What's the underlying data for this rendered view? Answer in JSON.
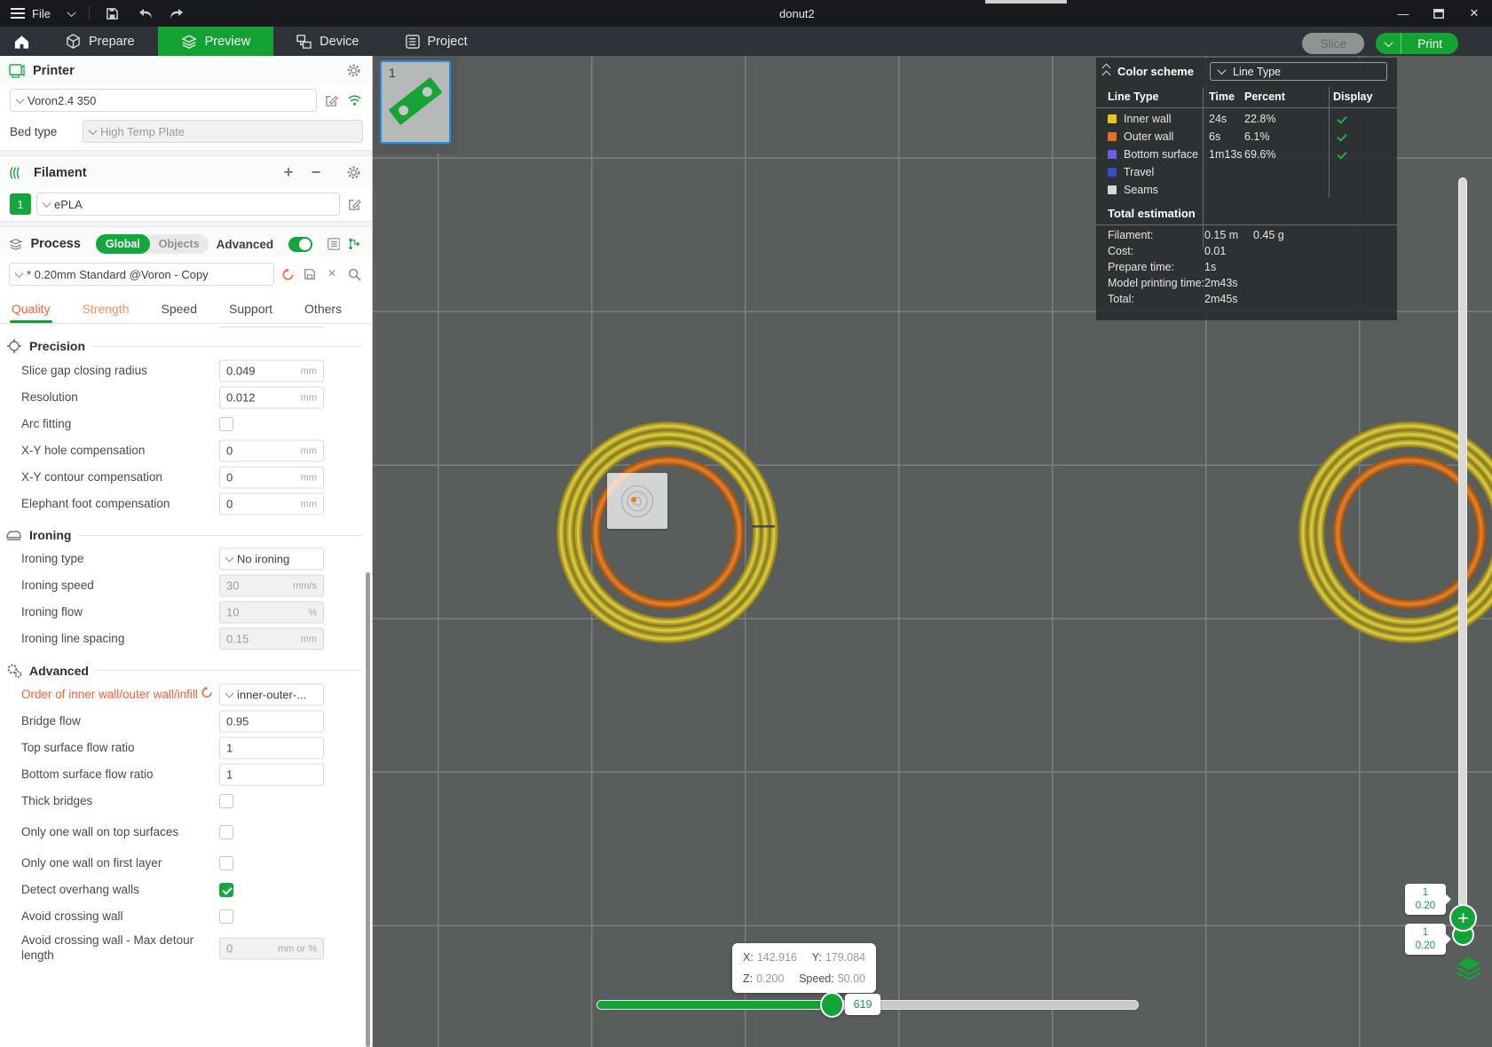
{
  "window": {
    "title": "donut2",
    "file_menu": "File"
  },
  "nav": {
    "tabs": [
      {
        "label": "Prepare"
      },
      {
        "label": "Preview"
      },
      {
        "label": "Device"
      },
      {
        "label": "Project"
      }
    ],
    "slice": "Slice",
    "print": "Print"
  },
  "colors": {
    "accent_green": "#15a63d",
    "preview_green": "#14a232",
    "modified_orange": "#fc5e33"
  },
  "printer": {
    "title": "Printer",
    "name": "Voron2.4 350",
    "bed_type_label": "Bed type",
    "bed_type_value": "High Temp Plate"
  },
  "filament": {
    "title": "Filament",
    "slot": "1",
    "name": "ePLA"
  },
  "process": {
    "title": "Process",
    "global": "Global",
    "objects": "Objects",
    "advanced": "Advanced",
    "preset": "* 0.20mm Standard @Voron - Copy"
  },
  "tabs": {
    "quality": "Quality",
    "strength": "Strength",
    "speed": "Speed",
    "support": "Support",
    "others": "Others"
  },
  "sections": {
    "precision": "Precision",
    "ironing": "Ironing",
    "advanced": "Advanced"
  },
  "rows": {
    "precision": [
      {
        "label": "Slice gap closing radius",
        "value": "0.049",
        "unit": "mm"
      },
      {
        "label": "Resolution",
        "value": "0.012",
        "unit": "mm"
      },
      {
        "label": "Arc fitting",
        "checked": false
      },
      {
        "label": "X-Y hole compensation",
        "value": "0",
        "unit": "mm"
      },
      {
        "label": "X-Y contour compensation",
        "value": "0",
        "unit": "mm"
      },
      {
        "label": "Elephant foot compensation",
        "value": "0",
        "unit": "mm"
      }
    ],
    "ironing": [
      {
        "label": "Ironing type",
        "value": "No ironing",
        "type": "select"
      },
      {
        "label": "Ironing speed",
        "value": "30",
        "unit": "mm/s",
        "disabled": true
      },
      {
        "label": "Ironing flow",
        "value": "10",
        "unit": "%",
        "disabled": true
      },
      {
        "label": "Ironing line spacing",
        "value": "0.15",
        "unit": "mm",
        "disabled": true
      }
    ],
    "advanced": [
      {
        "label": "Order of inner wall/outer wall/infill",
        "value": "inner-outer-...",
        "type": "select",
        "modified": true
      },
      {
        "label": "Bridge flow",
        "value": "0.95"
      },
      {
        "label": "Top surface flow ratio",
        "value": "1"
      },
      {
        "label": "Bottom surface flow ratio",
        "value": "1"
      },
      {
        "label": "Thick bridges",
        "checked": false
      },
      {
        "label": "Only one wall on top surfaces",
        "checked": false
      },
      {
        "label": "Only one wall on first layer",
        "checked": false
      },
      {
        "label": "Detect overhang walls",
        "checked": true
      },
      {
        "label": "Avoid crossing wall",
        "checked": false
      },
      {
        "label": "Avoid crossing wall - Max detour length",
        "value": "0",
        "unit": "mm or %",
        "disabled": true
      }
    ]
  },
  "legend": {
    "title": "Color scheme",
    "view_mode": "Line Type",
    "headers": {
      "line_type": "Line Type",
      "time": "Time",
      "percent": "Percent",
      "display": "Display"
    },
    "rows": [
      {
        "name": "Inner wall",
        "time": "24s",
        "percent": "22.8%",
        "swatch": "#e8c71d",
        "swatch_style": "background:#e8c71d",
        "display": true
      },
      {
        "name": "Outer wall",
        "time": "6s",
        "percent": "6.1%",
        "swatch": "#e3701f",
        "swatch_style": "background:#e3701f",
        "display": true
      },
      {
        "name": "Bottom surface",
        "time": "1m13s",
        "percent": "69.6%",
        "swatch": "#6f5ce8",
        "swatch_style": "background:#6f5ce8",
        "display": true
      },
      {
        "name": "Travel",
        "time": "",
        "percent": "",
        "swatch": "#3a4ccc",
        "swatch_style": "background:#3a4ccc",
        "display": false
      },
      {
        "name": "Seams",
        "time": "",
        "percent": "",
        "swatch": "#d9d9d9",
        "swatch_style": "background:#d9d9d9",
        "display": false
      }
    ],
    "estimation": {
      "title": "Total estimation",
      "rows": [
        {
          "label": "Filament:",
          "value": "0.15 m",
          "value2": "0.45 g"
        },
        {
          "label": "Cost:",
          "value": "0.01",
          "value2": ""
        },
        {
          "label": "Prepare time:",
          "value": "1s",
          "value2": ""
        },
        {
          "label": "Model printing time:",
          "value": "2m43s",
          "value2": ""
        },
        {
          "label": "Total:",
          "value": "2m45s",
          "value2": ""
        }
      ]
    }
  },
  "viewport": {
    "plate_number": "1",
    "layer_slider": {
      "upper": {
        "layer": "1",
        "height": "0.20"
      },
      "lower": {
        "layer": "1",
        "height": "0.20"
      }
    },
    "move_slider": {
      "value": "619"
    },
    "tooltip": {
      "x_label": "X:",
      "x": "142.916",
      "y_label": "Y:",
      "y": "179.084",
      "z_label": "Z:",
      "z": "0.200",
      "speed_label": "Speed:",
      "speed": "50.00"
    }
  }
}
